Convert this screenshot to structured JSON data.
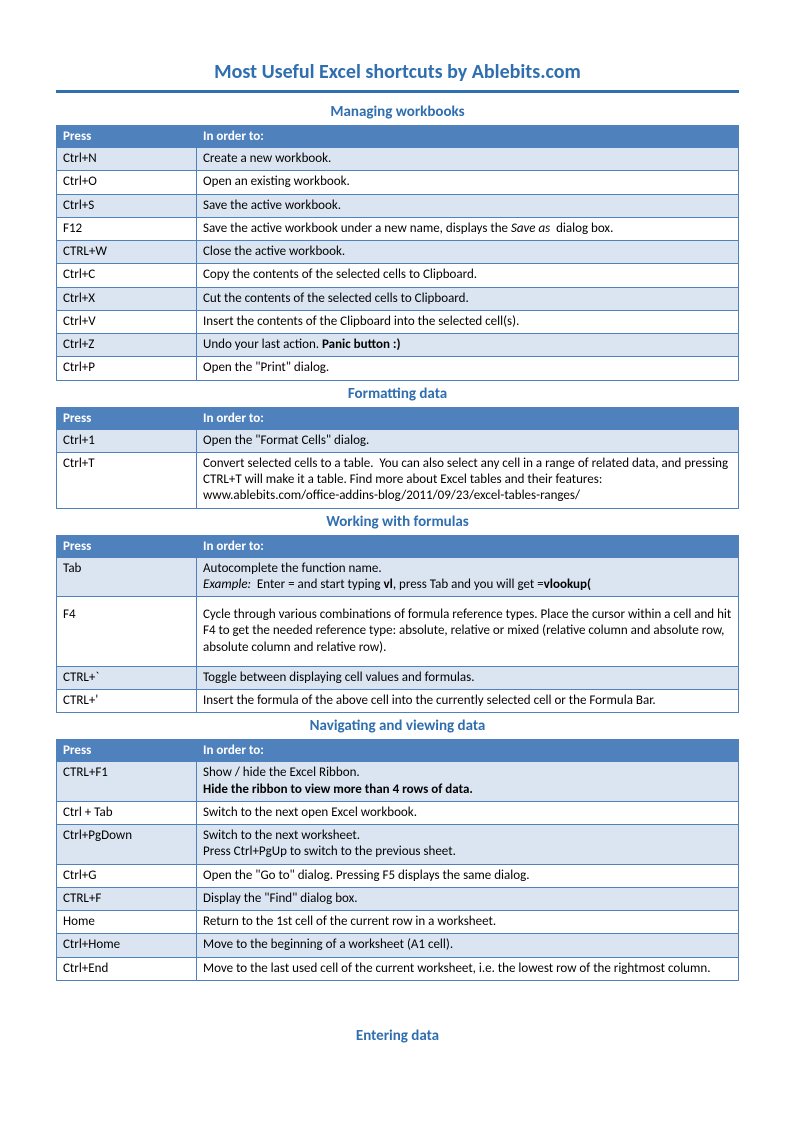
{
  "page_title": "Most Useful Excel shortcuts by Ablebits.com",
  "columns": {
    "press": "Press",
    "desc": "In order to:"
  },
  "sections": [
    {
      "title": "Managing workbooks",
      "rows": [
        {
          "press": "Ctrl+N",
          "desc": "Create a new workbook."
        },
        {
          "press": "Ctrl+O",
          "desc": "Open an existing workbook."
        },
        {
          "press": "Ctrl+S",
          "desc": "Save the active workbook."
        },
        {
          "press": "F12",
          "desc_html": "Save the active workbook under a new name, displays the <i>Save as</i>&nbsp; dialog box."
        },
        {
          "press": "CTRL+W",
          "desc": "Close the active workbook."
        },
        {
          "press": "Ctrl+C",
          "desc": "Copy the contents of the selected cells to Clipboard."
        },
        {
          "press": "Ctrl+X",
          "desc": "Cut the contents of the selected cells to Clipboard."
        },
        {
          "press": "Ctrl+V",
          "desc": "Insert the contents of the Clipboard into the selected cell(s)."
        },
        {
          "press": "Ctrl+Z",
          "desc_html": "Undo your last action. <b>Panic button :)</b>"
        },
        {
          "press": "Ctrl+P",
          "desc": "Open the \"Print\" dialog."
        }
      ]
    },
    {
      "title": "Formatting data",
      "rows": [
        {
          "press": "Ctrl+1",
          "desc": "Open the \"Format Cells\" dialog."
        },
        {
          "press": "Ctrl+T",
          "desc_html": "Convert selected cells to a table.&nbsp; You can also select any cell in a range of related data, and pressing CTRL+T will make it a table. Find more about Excel tables and their features:<br>www.ablebits.com/office-addins-blog/2011/09/23/excel-tables-ranges/"
        }
      ]
    },
    {
      "title": "Working with formulas",
      "rows": [
        {
          "press": "Tab",
          "desc_html": "Autocomplete the function name.<br><i>Example:</i>&nbsp; Enter = and start typing <b>vl</b>, press Tab and you will get =<b>vlookup(</b>"
        },
        {
          "press": "F4",
          "desc": "Cycle through various combinations of formula reference types. Place the cursor within a cell and hit F4 to get the needed reference type: absolute, relative or mixed (relative column and absolute row, absolute column and relative row).",
          "tallpad": true
        },
        {
          "press": "CTRL+`",
          "desc": "Toggle between displaying cell values and formulas."
        },
        {
          "press": "CTRL+'",
          "desc": "Insert the formula of the above cell into the currently selected cell or the Formula Bar."
        }
      ]
    },
    {
      "title": "Navigating and viewing data",
      "rows": [
        {
          "press": "CTRL+F1",
          "desc_html": "Show / hide the Excel Ribbon.<br><b>Hide the ribbon to view more than 4 rows of data.</b>"
        },
        {
          "press": "Ctrl + Tab",
          "desc": "Switch to the next open Excel workbook."
        },
        {
          "press": "Ctrl+PgDown",
          "desc_html": "Switch to the next worksheet.<br>Press Ctrl+PgUp to switch to the previous sheet."
        },
        {
          "press": "Ctrl+G",
          "desc": "Open the \"Go to\" dialog. Pressing F5 displays the same dialog."
        },
        {
          "press": "CTRL+F",
          "desc": "Display the \"Find\" dialog box."
        },
        {
          "press": "Home",
          "desc": "Return to the 1st cell of the current row in a worksheet."
        },
        {
          "press": "Ctrl+Home",
          "desc": "Move to the beginning of a worksheet (A1 cell)."
        },
        {
          "press": "Ctrl+End",
          "desc": "Move to the last used cell of the current worksheet, i.e. the lowest row of the rightmost column."
        }
      ]
    }
  ],
  "trailing_title": "Entering data"
}
